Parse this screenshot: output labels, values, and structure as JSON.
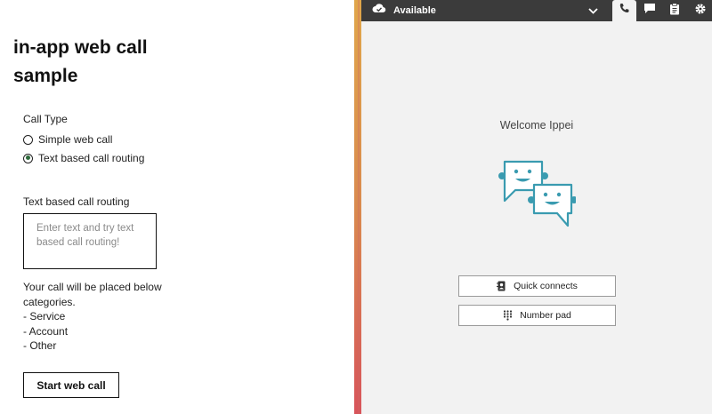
{
  "sample": {
    "title": "in-app web call sample",
    "call_type_label": "Call Type",
    "options": [
      {
        "label": "Simple web call",
        "checked": false
      },
      {
        "label": "Text based call routing",
        "checked": true
      }
    ],
    "routing_label": "Text based call routing",
    "routing_placeholder": "Enter text and try text based call routing!",
    "info_lines": [
      "Your call will be placed below categories.",
      "- Service",
      "- Account",
      "- Other"
    ],
    "start_button": "Start web call"
  },
  "ccp": {
    "status": "Available",
    "tabs": [
      {
        "icon": "phone-icon",
        "active": true
      },
      {
        "icon": "chat-icon",
        "active": false
      },
      {
        "icon": "clipboard-icon",
        "active": false
      },
      {
        "icon": "gear-icon",
        "active": false
      }
    ],
    "welcome": "Welcome Ippei",
    "quick_connects": "Quick connects",
    "number_pad": "Number pad",
    "colors": {
      "topbar": "#3b3b3b",
      "accent": "#3a9bb0",
      "panel": "#f2f2f2"
    }
  }
}
